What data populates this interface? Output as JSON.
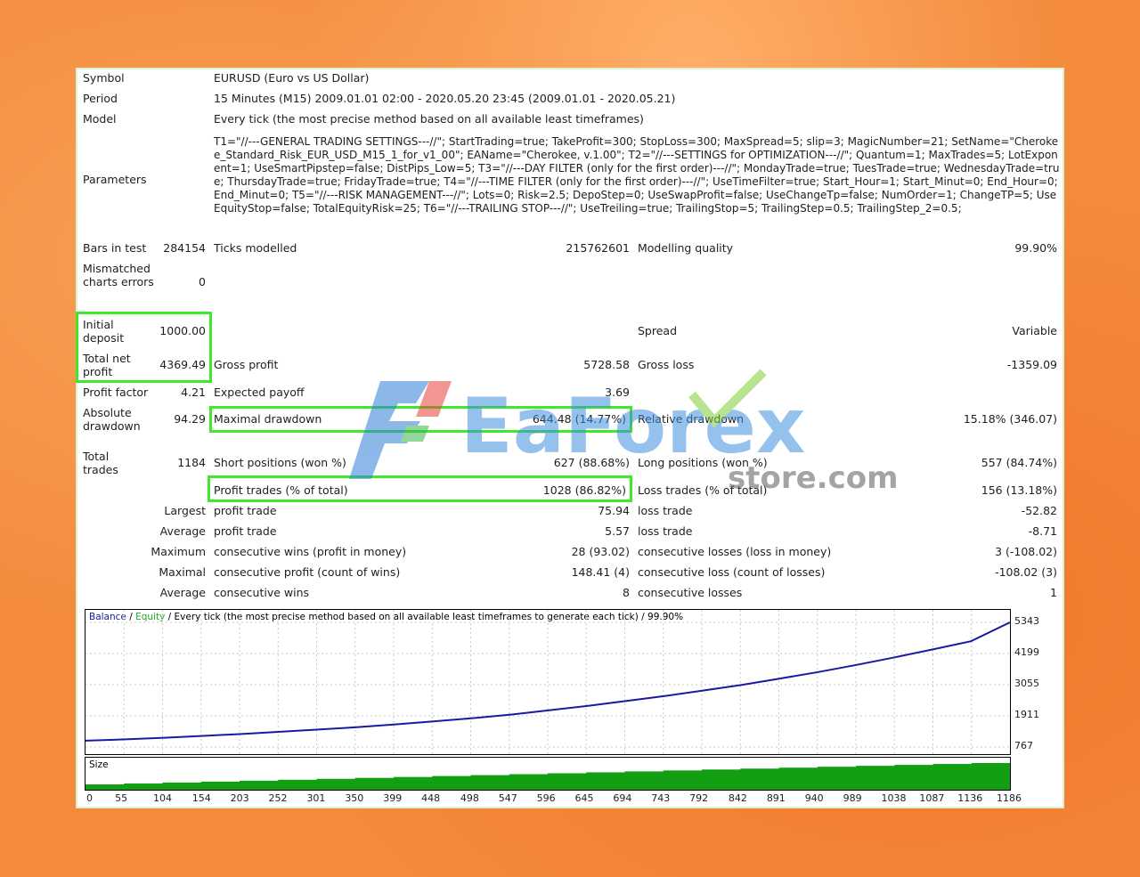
{
  "report": {
    "symbol_label": "Symbol",
    "symbol_value": "EURUSD (Euro vs US Dollar)",
    "period_label": "Period",
    "period_value": "15 Minutes (M15) 2009.01.01 02:00 - 2020.05.20 23:45 (2009.01.01 - 2020.05.21)",
    "model_label": "Model",
    "model_value": "Every tick (the most precise method based on all available least timeframes)",
    "parameters_label": "Parameters",
    "parameters_value": "T1=\"//---GENERAL TRADING SETTINGS---//\"; StartTrading=true; TakeProfit=300; StopLoss=300; MaxSpread=5; slip=3; MagicNumber=21; SetName=\"Cherokee_Standard_Risk_EUR_USD_M15_1_for_v1_00\"; EAName=\"Cherokee, v.1.00\"; T2=\"//---SETTINGS for OPTIMIZATION---//\"; Quantum=1; MaxTrades=5; LotExponent=1; UseSmartPipstep=false; DistPips_Low=5; T3=\"//---DAY FILTER (only for the first order)---//\"; MondayTrade=true; TuesTrade=true; WednesdayTrade=true; ThursdayTrade=true; FridayTrade=true; T4=\"//---TIME FILTER (only for the first order)---//\"; UseTimeFilter=true; Start_Hour=1; Start_Minut=0; End_Hour=0; End_Minut=0; T5=\"//---RISK MANAGEMENT---//\"; Lots=0; Risk=2.5; DepoStep=0; UseSwapProfit=false; UseChangeTp=false; NumOrder=1; ChangeTP=5; UseEquityStop=false; TotalEquityRisk=25; T6=\"//---TRAILING STOP---//\"; UseTreiling=true; TrailingStop=5; TrailingStep=0.5; TrailingStep_2=0.5;",
    "bars_label": "Bars in test",
    "bars_value": "284154",
    "ticks_label": "Ticks modelled",
    "ticks_value": "215762601",
    "mq_label": "Modelling quality",
    "mq_value": "99.90%",
    "mismatch_label": "Mismatched charts errors",
    "mismatch_value": "0",
    "deposit_label": "Initial deposit",
    "deposit_value": "1000.00",
    "spread_label": "Spread",
    "spread_value": "Variable",
    "netprofit_label": "Total net profit",
    "netprofit_value": "4369.49",
    "grossprofit_label": "Gross profit",
    "grossprofit_value": "5728.58",
    "grossloss_label": "Gross loss",
    "grossloss_value": "-1359.09",
    "pf_label": "Profit factor",
    "pf_value": "4.21",
    "ep_label": "Expected payoff",
    "ep_value": "3.69",
    "absdd_label": "Absolute drawdown",
    "absdd_value": "94.29",
    "maxdd_label": "Maximal drawdown",
    "maxdd_value": "644.48 (14.77%)",
    "reldd_label": "Relative drawdown",
    "reldd_value": "15.18% (346.07)",
    "trades_label": "Total trades",
    "trades_value": "1184",
    "short_label": "Short positions (won %)",
    "short_value": "627 (88.68%)",
    "long_label": "Long positions (won %)",
    "long_value": "557 (84.74%)",
    "pt_label": "Profit trades (% of total)",
    "pt_value": "1028 (86.82%)",
    "lt_label": "Loss trades (% of total)",
    "lt_value": "156 (13.18%)",
    "largest_label": "Largest",
    "largest_pt_label": "profit trade",
    "largest_pt_value": "75.94",
    "largest_lt_label": "loss trade",
    "largest_lt_value": "-52.82",
    "average_label": "Average",
    "average_pt_label": "profit trade",
    "average_pt_value": "5.57",
    "average_lt_label": "loss trade",
    "average_lt_value": "-8.71",
    "maximum_label": "Maximum",
    "max_cw_label": "consecutive wins (profit in money)",
    "max_cw_value": "28 (93.02)",
    "max_cl_label": "consecutive losses (loss in money)",
    "max_cl_value": "3 (-108.02)",
    "maximal_label": "Maximal",
    "mxl_cp_label": "consecutive profit (count of wins)",
    "mxl_cp_value": "148.41 (4)",
    "mxl_cl_label": "consecutive loss (count of losses)",
    "mxl_cl_value": "-108.02 (3)",
    "avg2_label": "Average",
    "avg_cw_label": "consecutive wins",
    "avg_cw_value": "8",
    "avg_cl_label": "consecutive losses",
    "avg_cl_value": "1"
  },
  "chart_legend": {
    "balance": "Balance",
    "sep1": " / ",
    "equity": "Equity",
    "rest": " / Every tick (the most precise method based on all available least timeframes to generate each tick) / 99.90%"
  },
  "size_label": "Size",
  "watermark": {
    "brand": "EaForex",
    "domain": "store.com"
  },
  "colors": {
    "highlight": "#3ee82b",
    "balance_line": "#1a1aa0",
    "equity": "#22aa22",
    "size_bars": "#12a012"
  },
  "chart_data": {
    "type": "line",
    "series": [
      {
        "name": "Balance",
        "x": [
          0,
          55,
          104,
          154,
          203,
          252,
          301,
          350,
          399,
          448,
          498,
          547,
          596,
          645,
          694,
          743,
          792,
          842,
          891,
          940,
          989,
          1038,
          1087,
          1136,
          1186
        ],
        "values": [
          1000,
          1050,
          1110,
          1180,
          1250,
          1330,
          1410,
          1500,
          1600,
          1710,
          1830,
          1960,
          2120,
          2280,
          2460,
          2640,
          2840,
          3050,
          3280,
          3520,
          3780,
          4060,
          4350,
          4650,
          5343
        ]
      }
    ],
    "y_ticks": [
      "5343",
      "4199",
      "3055",
      "1911",
      "767"
    ],
    "x_ticks": [
      "0",
      "55",
      "104",
      "154",
      "203",
      "252",
      "301",
      "350",
      "399",
      "448",
      "498",
      "547",
      "596",
      "645",
      "694",
      "743",
      "792",
      "842",
      "891",
      "940",
      "989",
      "1038",
      "1087",
      "1136",
      "1186"
    ],
    "ylim": [
      767,
      5343
    ],
    "xlim": [
      0,
      1186
    ]
  }
}
